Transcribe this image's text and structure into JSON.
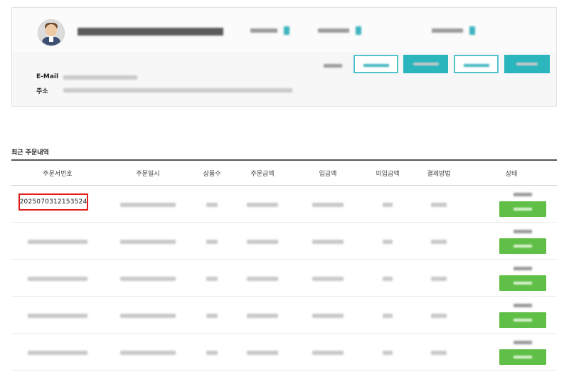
{
  "member": {
    "info_labels": {
      "email": "E-Mail",
      "address": "주소"
    }
  },
  "orders": {
    "section_title": "최근 주문내역",
    "headers": [
      "주문서번호",
      "주문일시",
      "상품수",
      "주문금액",
      "입금액",
      "미입금액",
      "결제방법",
      "상태"
    ],
    "rows": [
      {
        "order_no": "2025070312153524"
      },
      {
        "order_no": ""
      },
      {
        "order_no": ""
      },
      {
        "order_no": ""
      },
      {
        "order_no": ""
      }
    ]
  },
  "colors": {
    "accent_teal": "#2bb5bd",
    "status_green": "#5fbf46",
    "highlight_red": "#e21b1b"
  }
}
